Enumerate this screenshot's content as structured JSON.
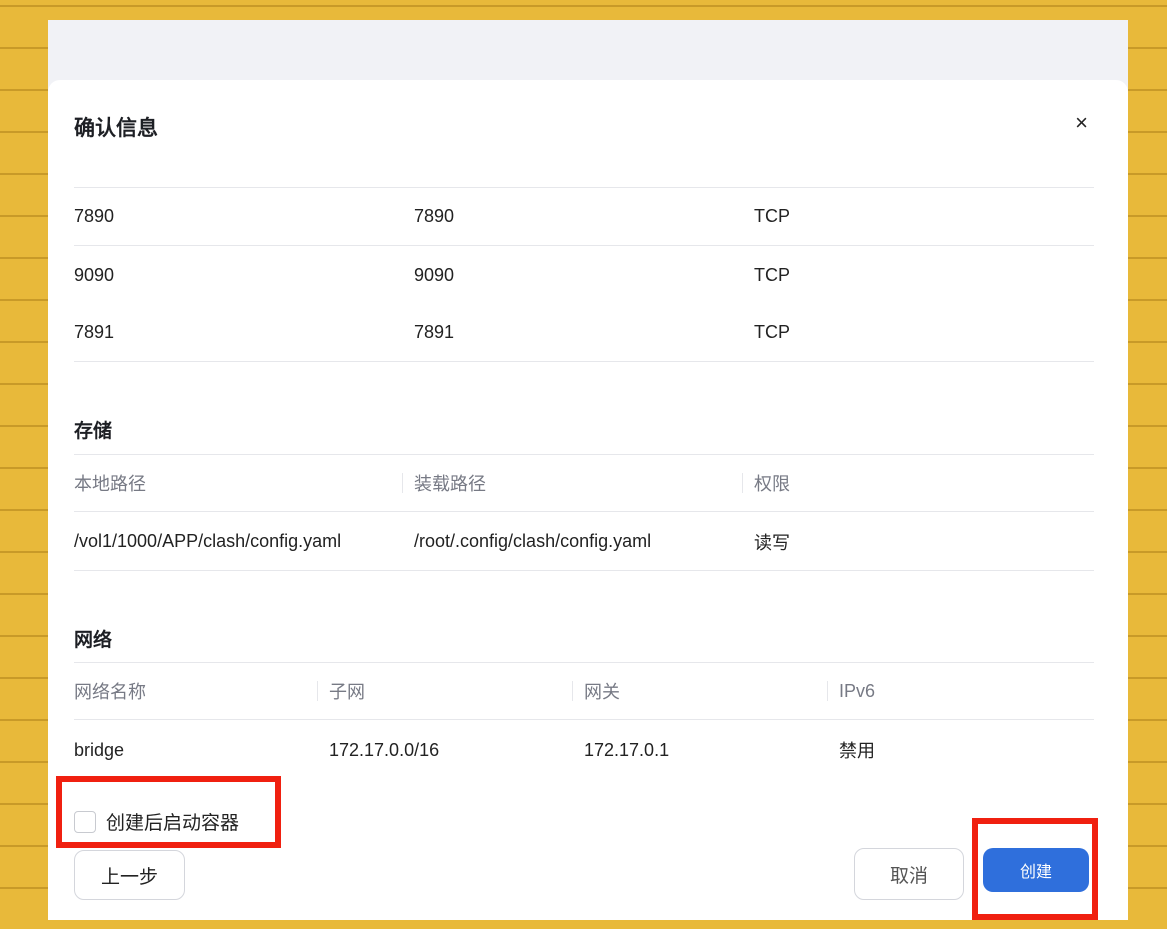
{
  "dialog": {
    "title": "确认信息",
    "close": "×"
  },
  "ports": {
    "rows": [
      [
        "7890",
        "7890",
        "TCP"
      ],
      [
        "9090",
        "9090",
        "TCP"
      ],
      [
        "7891",
        "7891",
        "TCP"
      ]
    ]
  },
  "storage": {
    "title": "存储",
    "headers": [
      "本地路径",
      "装载路径",
      "权限"
    ],
    "row": [
      "/vol1/1000/APP/clash/config.yaml",
      "/root/.config/clash/config.yaml",
      "读写"
    ]
  },
  "network": {
    "title": "网络",
    "headers": [
      "网络名称",
      "子网",
      "网关",
      "IPv6"
    ],
    "row": [
      "bridge",
      "172.17.0.0/16",
      "172.17.0.1",
      "禁用"
    ]
  },
  "start_after_create": {
    "label": "创建后启动容器",
    "checked": false
  },
  "buttons": {
    "prev": "上一步",
    "cancel": "取消",
    "create": "创建"
  },
  "colors": {
    "primary": "#2f6fdc",
    "highlight": "#f02010"
  }
}
